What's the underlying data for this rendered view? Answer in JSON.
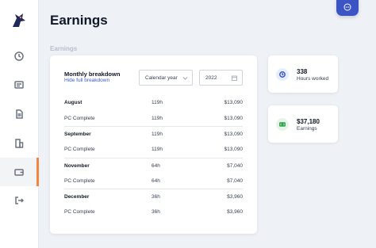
{
  "page": {
    "title": "Earnings",
    "section_label": "Earnings"
  },
  "colors": {
    "accent_orange": "#f4843e",
    "primary_blue": "#3b55c4",
    "hours_icon_bg": "#e7eefc",
    "earnings_icon_bg": "#e6f5e9"
  },
  "sidebar": {
    "items": [
      {
        "icon": "clock-icon"
      },
      {
        "icon": "id-card-icon"
      },
      {
        "icon": "document-icon"
      },
      {
        "icon": "building-icon"
      },
      {
        "icon": "wallet-icon",
        "active": true
      },
      {
        "icon": "logout-icon"
      }
    ]
  },
  "breakdown": {
    "title": "Monthly breakdown",
    "toggle_link": "Hide full breakdown",
    "period_select": "Calendar year",
    "year": "2022",
    "rows": [
      {
        "label": "August",
        "hours": "119h",
        "amount": "$13,090",
        "type": "month"
      },
      {
        "label": "PC Complete",
        "hours": "119h",
        "amount": "$13,090",
        "type": "client"
      },
      {
        "label": "September",
        "hours": "119h",
        "amount": "$13,090",
        "type": "month"
      },
      {
        "label": "PC Complete",
        "hours": "119h",
        "amount": "$13,090",
        "type": "client"
      },
      {
        "label": "November",
        "hours": "64h",
        "amount": "$7,040",
        "type": "month"
      },
      {
        "label": "PC Complete",
        "hours": "64h",
        "amount": "$7,040",
        "type": "client"
      },
      {
        "label": "December",
        "hours": "36h",
        "amount": "$3,960",
        "type": "month"
      },
      {
        "label": "PC Complete",
        "hours": "36h",
        "amount": "$3,960",
        "type": "client"
      }
    ]
  },
  "stats": {
    "hours": {
      "value": "338",
      "label": "Hours worked",
      "icon": "clock-icon"
    },
    "earnings": {
      "value": "$37,180",
      "label": "Earnings",
      "icon": "money-icon"
    }
  }
}
